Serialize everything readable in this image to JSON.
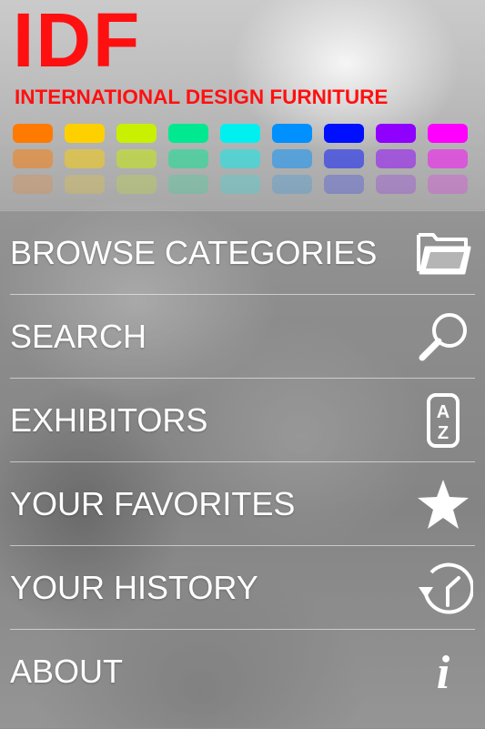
{
  "header": {
    "logo": "IDF",
    "subtitle": "INTERNATIONAL DESIGN FURNITURE",
    "palette": [
      "#ff7a00",
      "#ffd000",
      "#c8f000",
      "#00e890",
      "#00f0f0",
      "#0090ff",
      "#0010ff",
      "#9000ff",
      "#ff00ff"
    ],
    "brand_color": "#ff1010"
  },
  "menu": {
    "items": [
      {
        "label": "BROWSE CATEGORIES",
        "icon": "folder-icon"
      },
      {
        "label": "SEARCH",
        "icon": "search-icon"
      },
      {
        "label": "EXHIBITORS",
        "icon": "a-z-icon",
        "icon_text_top": "A",
        "icon_text_bottom": "Z"
      },
      {
        "label": "YOUR FAVORITES",
        "icon": "star-icon"
      },
      {
        "label": "YOUR HISTORY",
        "icon": "history-clock-icon"
      },
      {
        "label": "ABOUT",
        "icon": "info-icon",
        "icon_text": "i"
      }
    ]
  }
}
